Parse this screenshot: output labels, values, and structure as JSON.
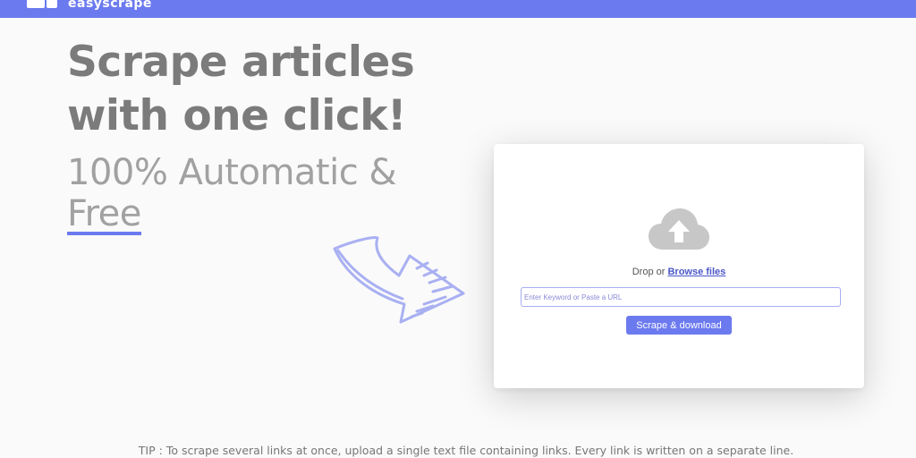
{
  "header": {
    "logo_text": "easyscrape",
    "color": "#6c7aef"
  },
  "hero": {
    "title_line1": "Scrape articles",
    "title_line2": "with one click!",
    "subtitle_line1": "100% Automatic &",
    "subtitle_free": "Free"
  },
  "upload_card": {
    "icon": "cloud-upload-icon",
    "drop_text": "Drop or ",
    "browse_label": "Browse files",
    "input_placeholder": "Enter Keyword or Paste a URL",
    "input_value": "",
    "button_label": "Scrape & download"
  },
  "decor": {
    "arrow_icon": "hand-drawn-arrow-icon",
    "accent_color": "#6c7aef"
  },
  "tip": {
    "text": "TIP : To scrape several links at once, upload a single text file containing links. Every link is written on a separate line."
  }
}
